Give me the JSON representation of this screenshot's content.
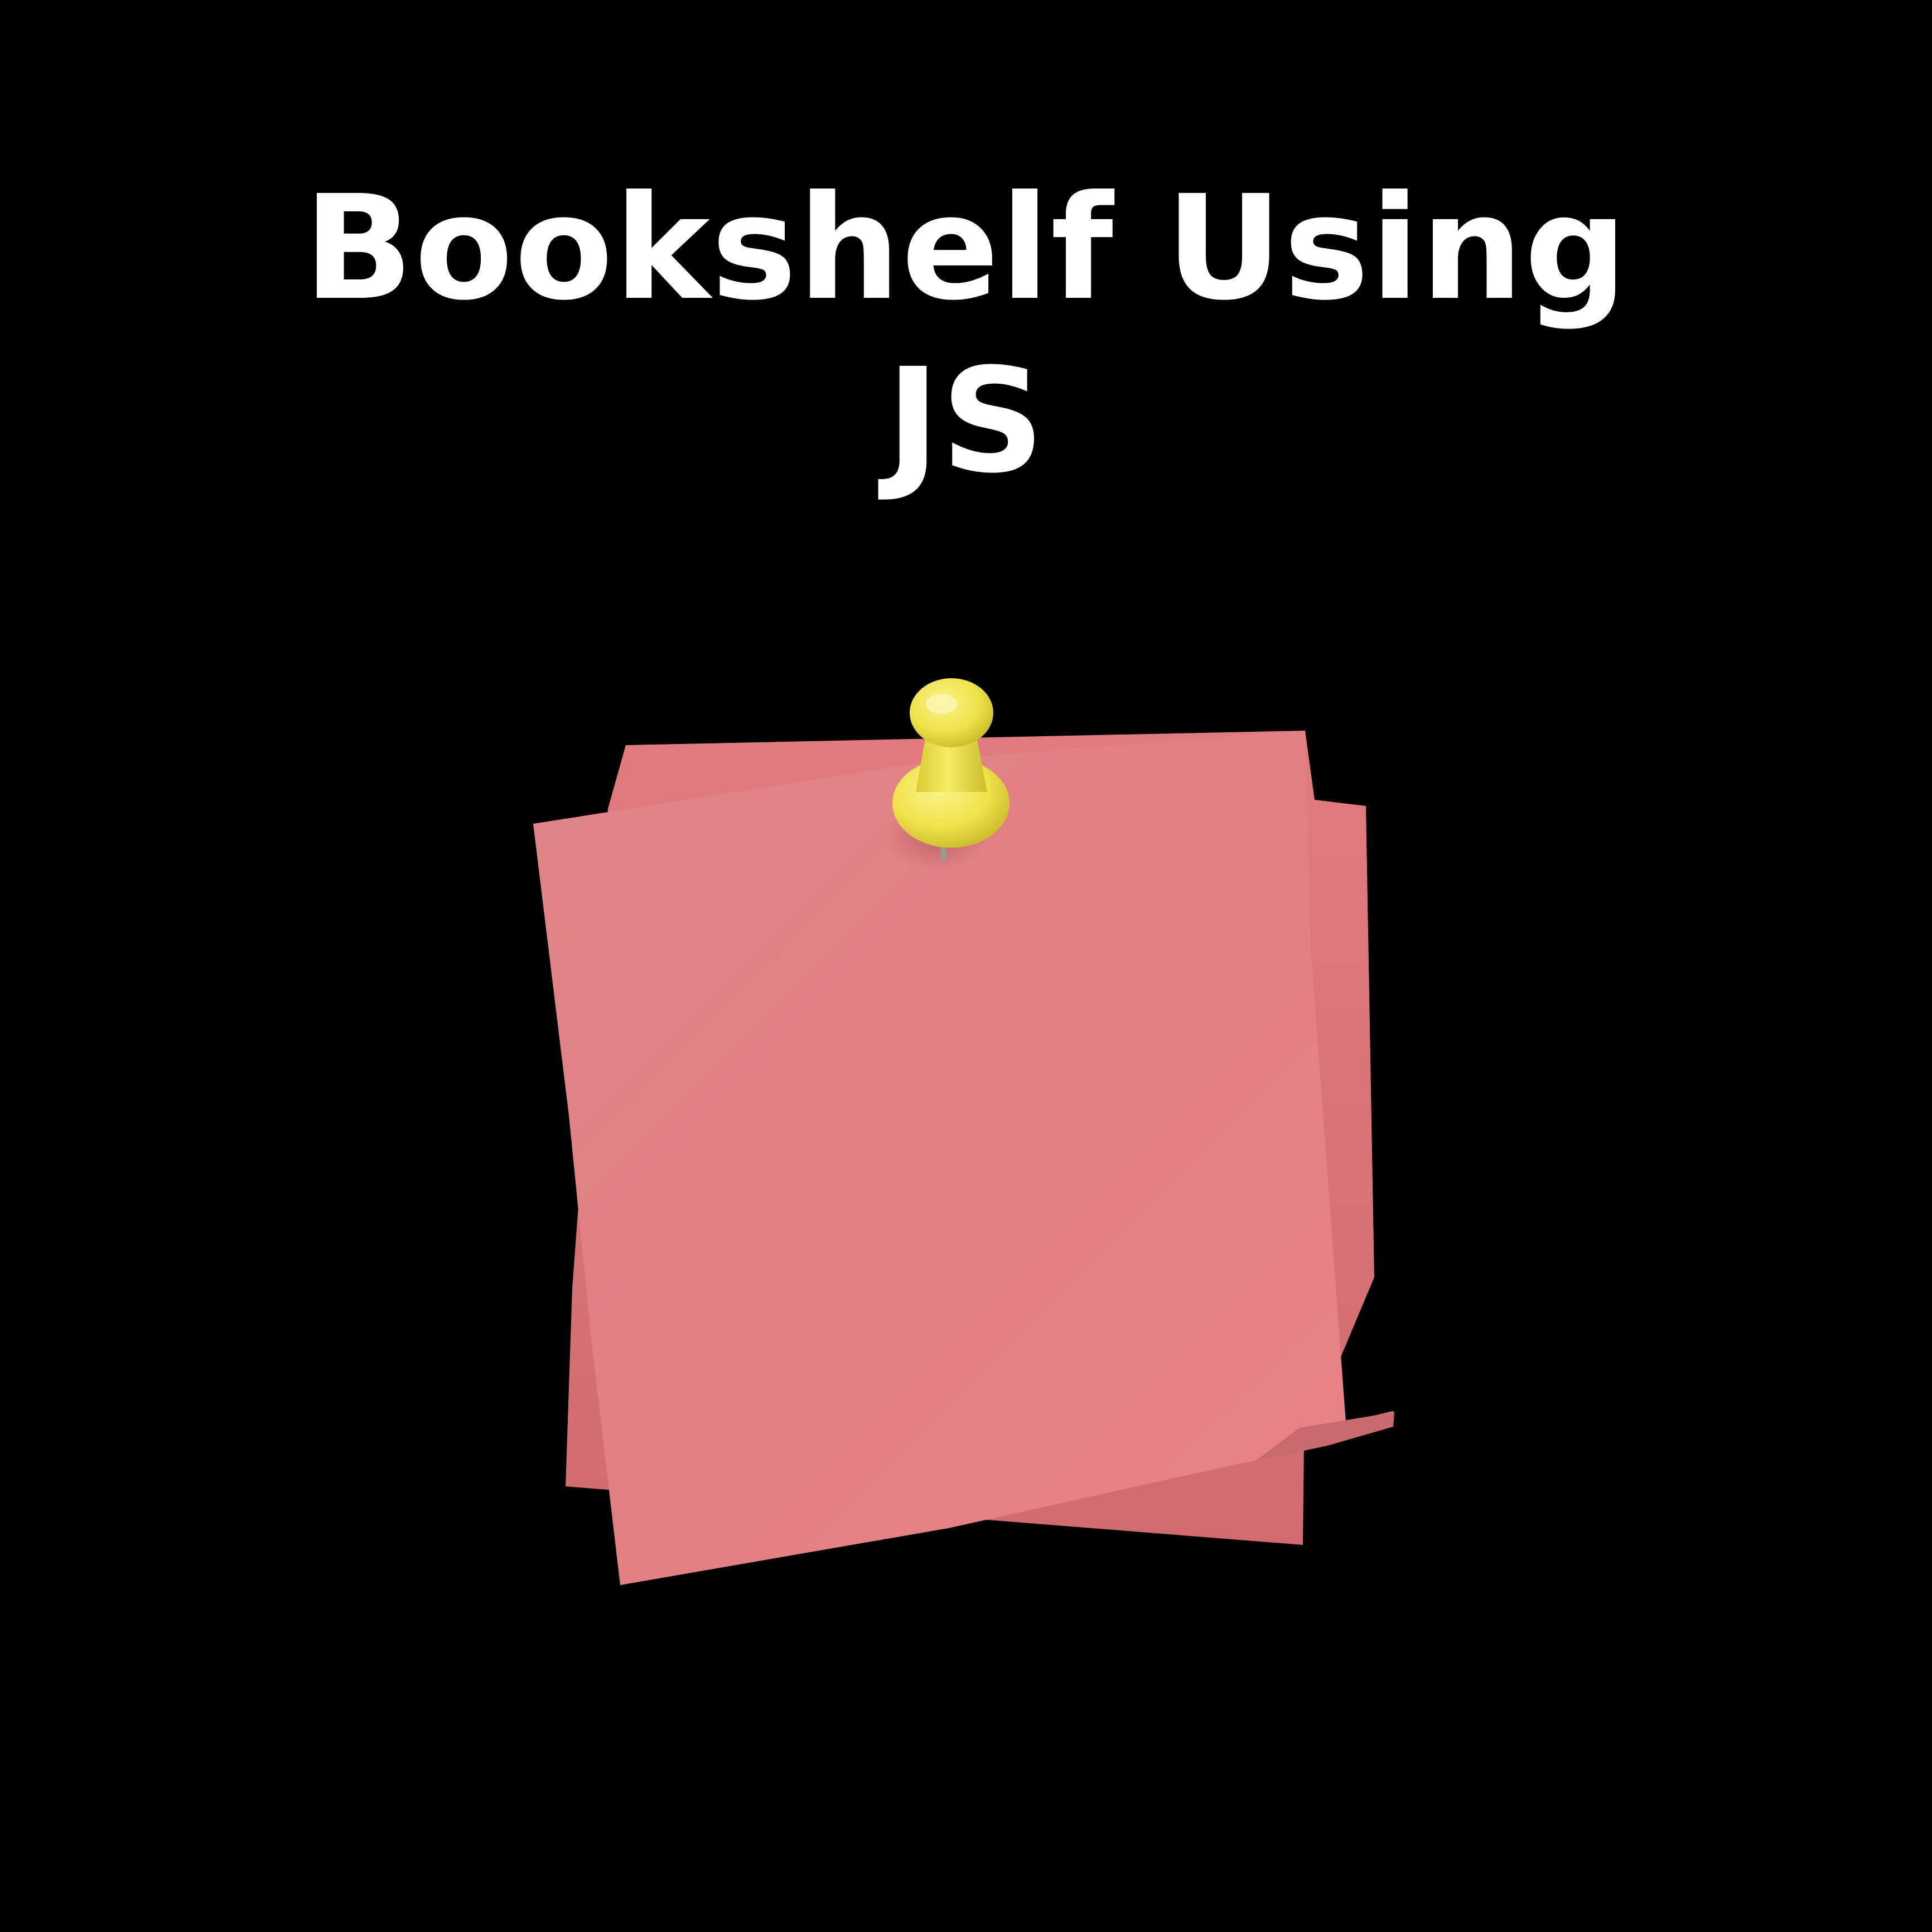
{
  "title": {
    "line1": "Bookshelf Using",
    "line2": "JS"
  },
  "colors": {
    "background": "#000000",
    "text": "#ffffff",
    "note_front": "#e38384",
    "note_back": "#da7174",
    "pin": "#f2e64f"
  },
  "icons": {
    "note": "sticky-note-icon",
    "pin": "pushpin-icon"
  }
}
